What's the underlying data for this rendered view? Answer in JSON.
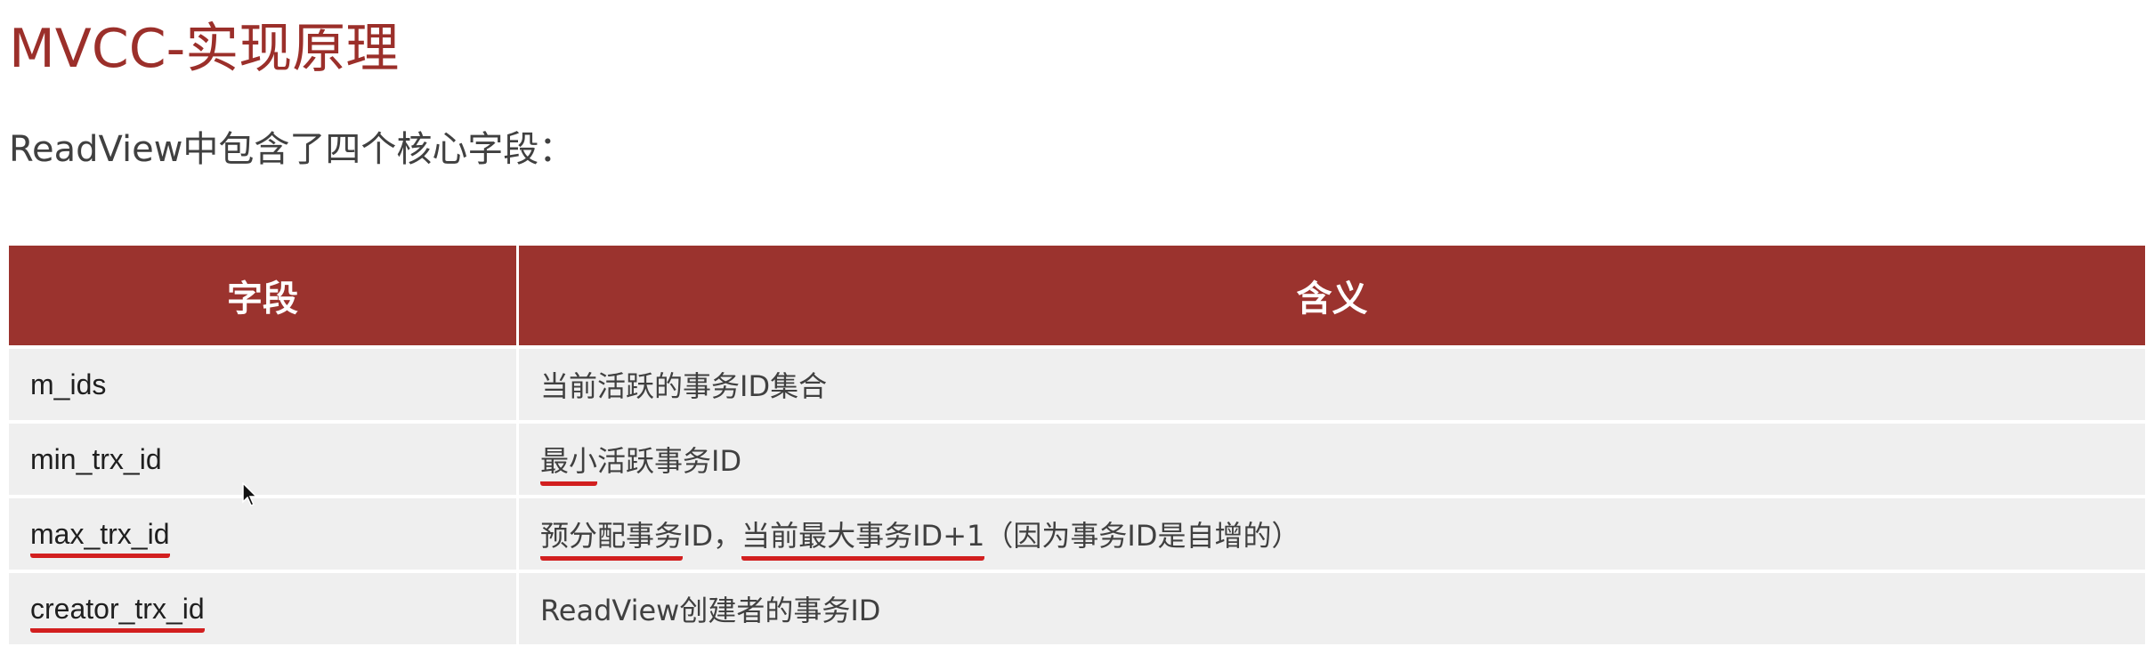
{
  "title": "MVCC-实现原理",
  "subtitle": "ReadView中包含了四个核心字段：",
  "table": {
    "headers": [
      "字段",
      "含义"
    ],
    "rows": [
      {
        "field": "m_ids",
        "meaning": "当前活跃的事务ID集合"
      },
      {
        "field": "min_trx_id",
        "meaning_underlined": "最小",
        "meaning_rest": "活跃事务ID"
      },
      {
        "field": "max_trx_id",
        "meaning_part1": "预分配事务",
        "meaning_part2": "ID，",
        "meaning_part3": "当前最大事务ID+1",
        "meaning_part4": "（因为事务ID是自增的）"
      },
      {
        "field": "creator_trx_id",
        "meaning": "ReadView创建者的事务ID"
      }
    ]
  },
  "colors": {
    "title": "#9b2f2a",
    "header_bg": "#9b332e",
    "row_bg": "#efefef",
    "underline": "#d21f1f"
  }
}
